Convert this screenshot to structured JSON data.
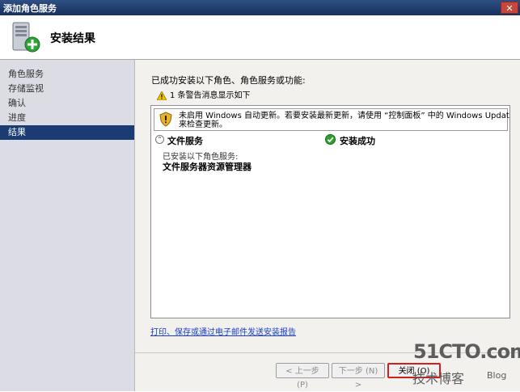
{
  "window": {
    "title": "添加角色服务",
    "close_glyph": "✕"
  },
  "header": {
    "title": "安装结果",
    "icon": "server-install-icon"
  },
  "sidebar": {
    "items": [
      {
        "label": "角色服务",
        "active": false
      },
      {
        "label": "存储监视",
        "active": false
      },
      {
        "label": "确认",
        "active": false
      },
      {
        "label": "进度",
        "active": false
      },
      {
        "label": "结果",
        "active": true
      }
    ]
  },
  "main": {
    "summary": "已成功安装以下角色、角色服务或功能:",
    "warning_count_text": "1 条警告消息显示如下",
    "notice_line1": "未启用 Windows 自动更新。若要安装最新更新，请使用 “控制面板” 中的 Windows Update",
    "notice_line2": "来检查更新。",
    "role_name": "文件服务",
    "role_status": "安装成功",
    "installed_label": "已安装以下角色服务:",
    "installed_item": "文件服务器资源管理器",
    "report_link": "打印、保存或通过电子邮件发送安装报告"
  },
  "buttons": {
    "prev": "< 上一步 (P)",
    "next": "下一步 (N) >",
    "close": "关闭 (O)"
  },
  "watermark": {
    "site": "51CTO.com",
    "subtitle": "技术博客",
    "blog": "Blog"
  },
  "colors": {
    "accent": "#1b3b73",
    "link": "#1a3ec2",
    "highlight": "#d0201b",
    "success": "#2f9e2f",
    "warning": "#f2c200"
  }
}
